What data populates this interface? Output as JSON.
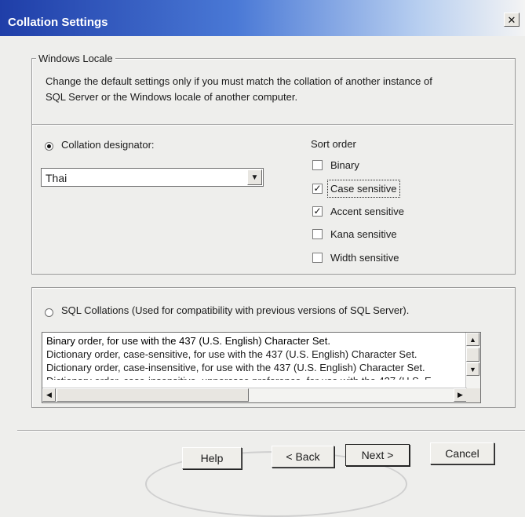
{
  "window": {
    "title": "Collation Settings",
    "close_glyph": "✕",
    "close_icon": "close-icon"
  },
  "windows_locale": {
    "group_label": "Windows Locale",
    "description_line1": "Change the default settings only if you must match the collation of another instance of",
    "description_line2": "SQL Server or the Windows locale of another computer."
  },
  "collation": {
    "radio_label": "Collation designator:",
    "selected": true,
    "combo_value": "Thai",
    "combo_arrow": "▼"
  },
  "sort_order": {
    "label": "Sort order",
    "options": [
      {
        "label": "Binary",
        "checked": false,
        "mark": ""
      },
      {
        "label": "Case sensitive",
        "checked": true,
        "mark": "✓"
      },
      {
        "label": "Accent sensitive",
        "checked": true,
        "mark": "✓"
      },
      {
        "label": "Kana sensitive",
        "checked": false,
        "mark": ""
      },
      {
        "label": "Width sensitive",
        "checked": false,
        "mark": ""
      }
    ]
  },
  "sql_collations": {
    "radio_label": "SQL Collations (Used for compatibility with previous versions of SQL Server).",
    "selected": false,
    "items": [
      "Binary order, for use with the 437 (U.S. English) Character Set.",
      "Dictionary order, case-sensitive, for use with the 437 (U.S. English) Character Set.",
      "Dictionary order, case-insensitive, for use with the 437 (U.S. English) Character Set.",
      "Dictionary order, case-insensitive, uppercase preference, for use with the 437 (U.S. E"
    ],
    "scroll_up": "▲",
    "scroll_down": "▼",
    "scroll_left": "◀",
    "scroll_right": "▶"
  },
  "buttons": {
    "help": "Help",
    "back": "< Back",
    "next": "Next >",
    "cancel": "Cancel"
  }
}
